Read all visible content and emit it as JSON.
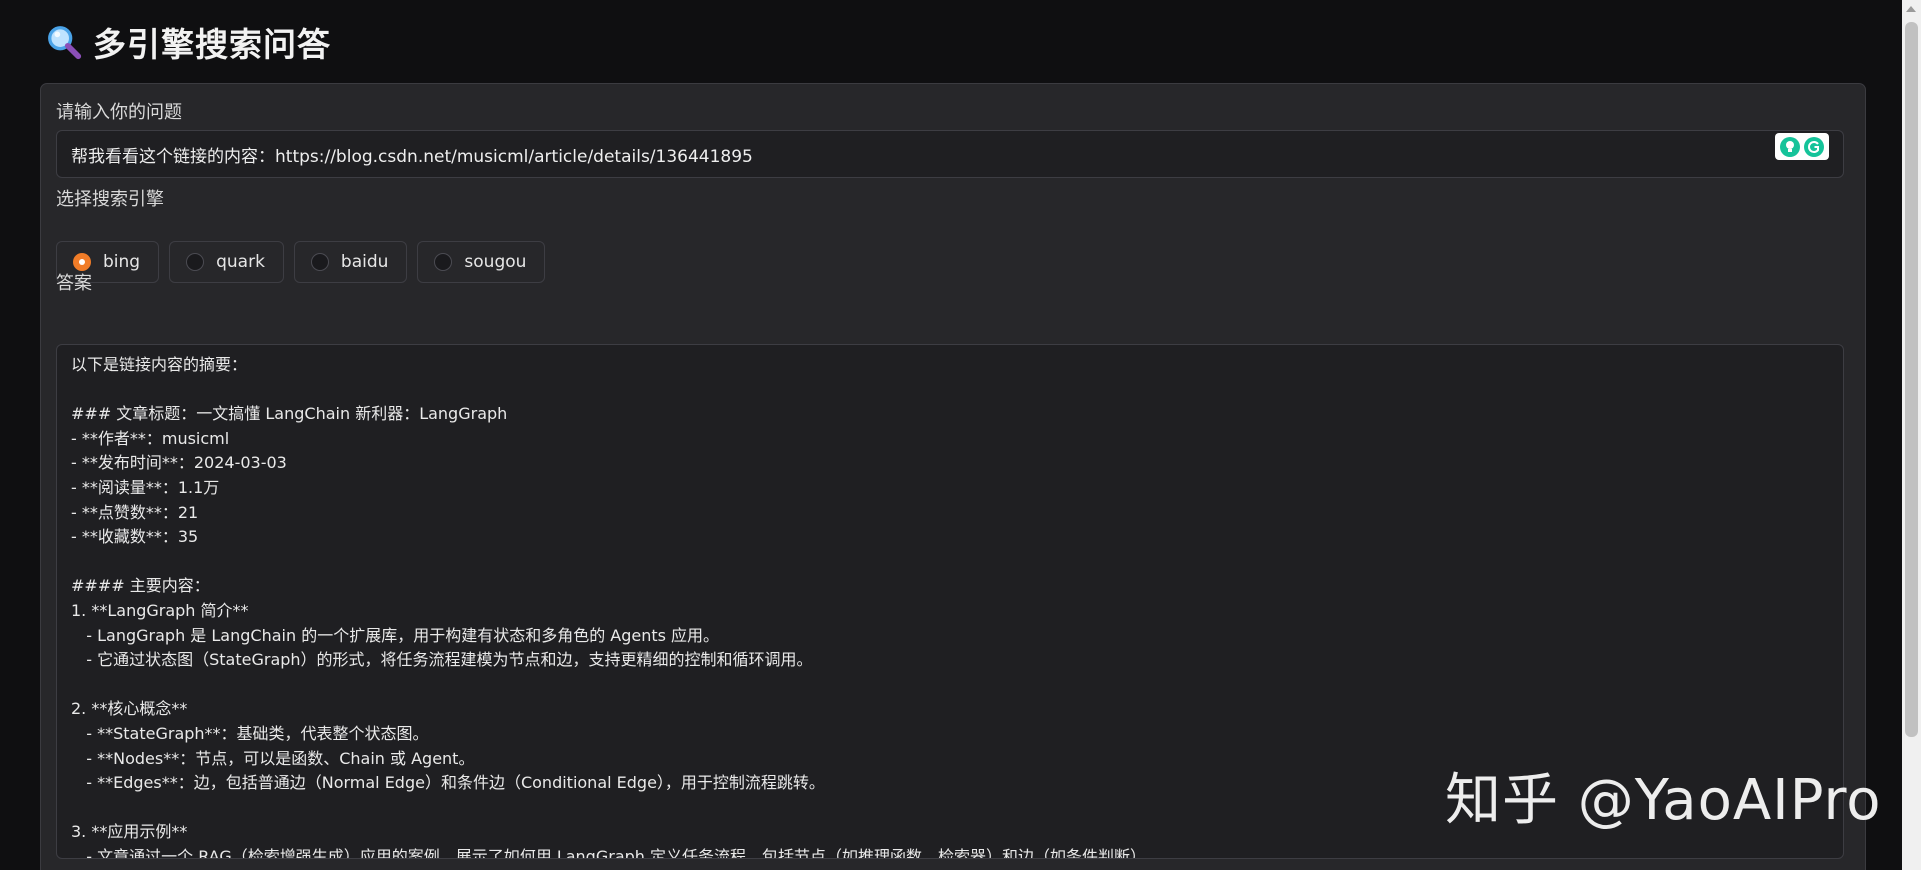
{
  "app": {
    "title": "多引擎搜索问答",
    "title_icon": "magnifier-icon"
  },
  "question": {
    "label": "请输入你的问题",
    "value": "帮我看看这个链接的内容：https://blog.csdn.net/musicml/article/details/136441895",
    "extension_icons": [
      "bulb-icon",
      "grammarly-icon"
    ]
  },
  "engine": {
    "label": "选择搜索引擎",
    "selected": "bing",
    "options": [
      "bing",
      "quark",
      "baidu",
      "sougou"
    ],
    "accent_color": "#f07c28"
  },
  "answer": {
    "label": "答案",
    "text": "以下是链接内容的摘要：\n\n### 文章标题：一文搞懂 LangChain 新利器：LangGraph\n- **作者**：musicml\n- **发布时间**：2024-03-03\n- **阅读量**：1.1万\n- **点赞数**：21\n- **收藏数**：35\n\n#### 主要内容：\n1. **LangGraph 简介**\n   - LangGraph 是 LangChain 的一个扩展库，用于构建有状态和多角色的 Agents 应用。\n   - 它通过状态图（StateGraph）的形式，将任务流程建模为节点和边，支持更精细的控制和循环调用。\n\n2. **核心概念**\n   - **StateGraph**：基础类，代表整个状态图。\n   - **Nodes**：节点，可以是函数、Chain 或 Agent。\n   - **Edges**：边，包括普通边（Normal Edge）和条件边（Conditional Edge），用于控制流程跳转。\n\n3. **应用示例**\n   - 文章通过一个 RAG（检索增强生成）应用的案例，展示了如何用 LangGraph 定义任务流程，包括节点（如推理函数、检索器）和边（如条件判断）。"
  },
  "watermark": "知乎 @YaoAIPro"
}
